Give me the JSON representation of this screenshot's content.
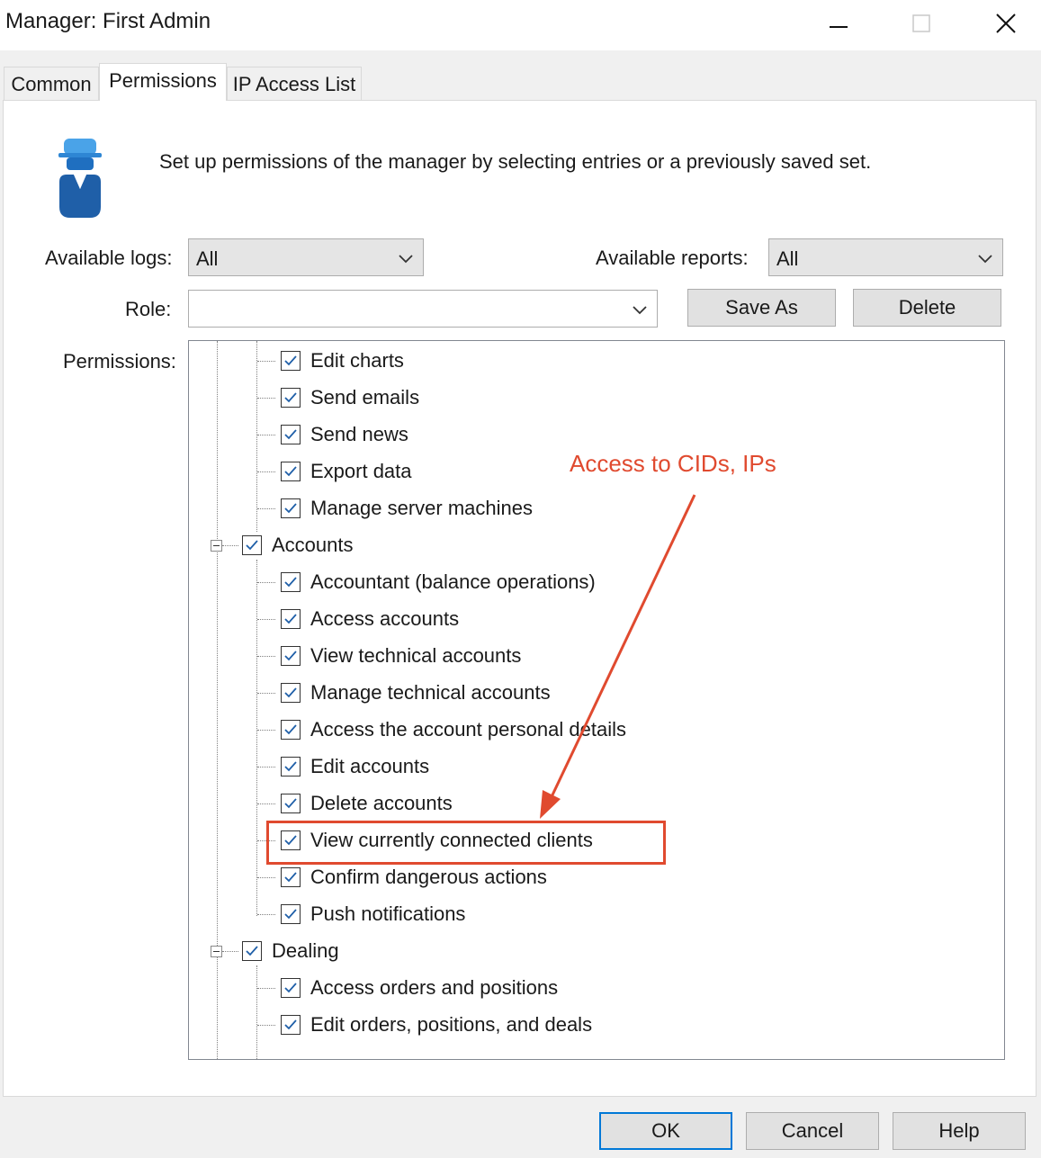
{
  "window": {
    "title": "Manager: First Admin"
  },
  "tabs": [
    {
      "label": "Common"
    },
    {
      "label": "Permissions"
    },
    {
      "label": "IP Access List"
    }
  ],
  "description": "Set up permissions of the manager by selecting entries or a previously saved set.",
  "filters": {
    "logs_label": "Available logs:",
    "logs_value": "All",
    "reports_label": "Available reports:",
    "reports_value": "All",
    "role_label": "Role:",
    "role_value": "",
    "save_as": "Save As",
    "delete": "Delete"
  },
  "permissions_label": "Permissions:",
  "tree": {
    "rows": [
      {
        "label": "Edit charts",
        "checked": true
      },
      {
        "label": "Send emails",
        "checked": true
      },
      {
        "label": "Send news",
        "checked": true
      },
      {
        "label": "Export data",
        "checked": true
      },
      {
        "label": "Manage server machines",
        "checked": true
      },
      {
        "label": "Accounts",
        "checked": true
      },
      {
        "label": "Accountant (balance operations)",
        "checked": true
      },
      {
        "label": "Access accounts",
        "checked": true
      },
      {
        "label": "View technical accounts",
        "checked": true
      },
      {
        "label": "Manage technical accounts",
        "checked": true
      },
      {
        "label": "Access the account personal details",
        "checked": true
      },
      {
        "label": "Edit accounts",
        "checked": true
      },
      {
        "label": "Delete accounts",
        "checked": true
      },
      {
        "label": "View currently connected clients",
        "checked": true
      },
      {
        "label": "Confirm dangerous actions",
        "checked": true
      },
      {
        "label": "Push notifications",
        "checked": true
      },
      {
        "label": "Dealing",
        "checked": true
      },
      {
        "label": "Access orders and positions",
        "checked": true
      },
      {
        "label": "Edit orders, positions, and deals",
        "checked": true
      }
    ]
  },
  "annotation": {
    "text": "Access to CIDs, IPs",
    "color": "#e04a2f"
  },
  "footer": {
    "ok": "OK",
    "cancel": "Cancel",
    "help": "Help"
  }
}
